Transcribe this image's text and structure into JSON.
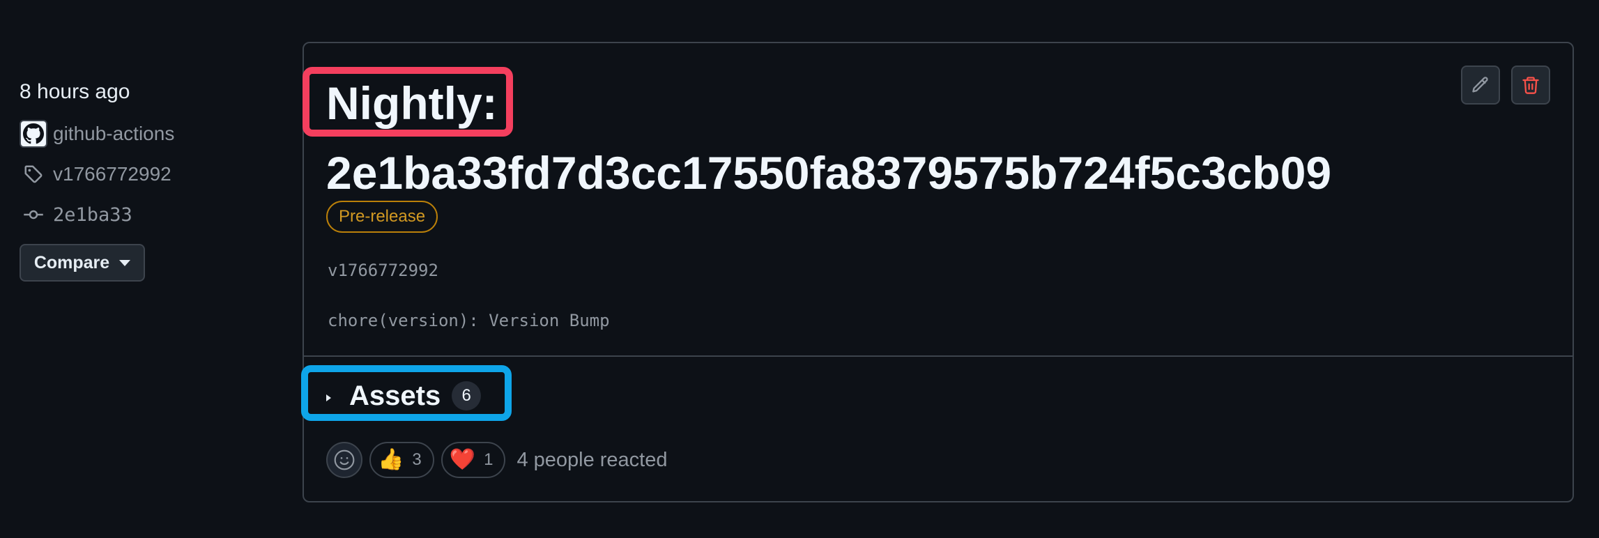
{
  "sidebar": {
    "time": "8 hours ago",
    "author": "github-actions",
    "tag": "v1766772992",
    "commit": "2e1ba33",
    "compare_label": "Compare"
  },
  "release": {
    "title_line1": "Nightly:",
    "title_line2": "2e1ba33fd7d3cc17550fa8379575b724f5c3cb09",
    "badge": "Pre-release",
    "body_version": "v1766772992",
    "body_commit_msg": "chore(version): Version Bump"
  },
  "assets": {
    "label": "Assets",
    "count": "6"
  },
  "reactions": {
    "items": [
      {
        "emoji": "👍",
        "icon": "thumbs-up-icon",
        "count": "3"
      },
      {
        "emoji": "❤️",
        "icon": "heart-icon",
        "count": "1"
      }
    ],
    "summary": "4 people reacted"
  },
  "annotations": {
    "title_highlight_color": "#f43f5e",
    "assets_highlight_color": "#0ea5e9"
  },
  "colors": {
    "background": "#0d1117",
    "border": "#3d444d",
    "prerelease": "#d29922",
    "delete": "#f85149"
  }
}
